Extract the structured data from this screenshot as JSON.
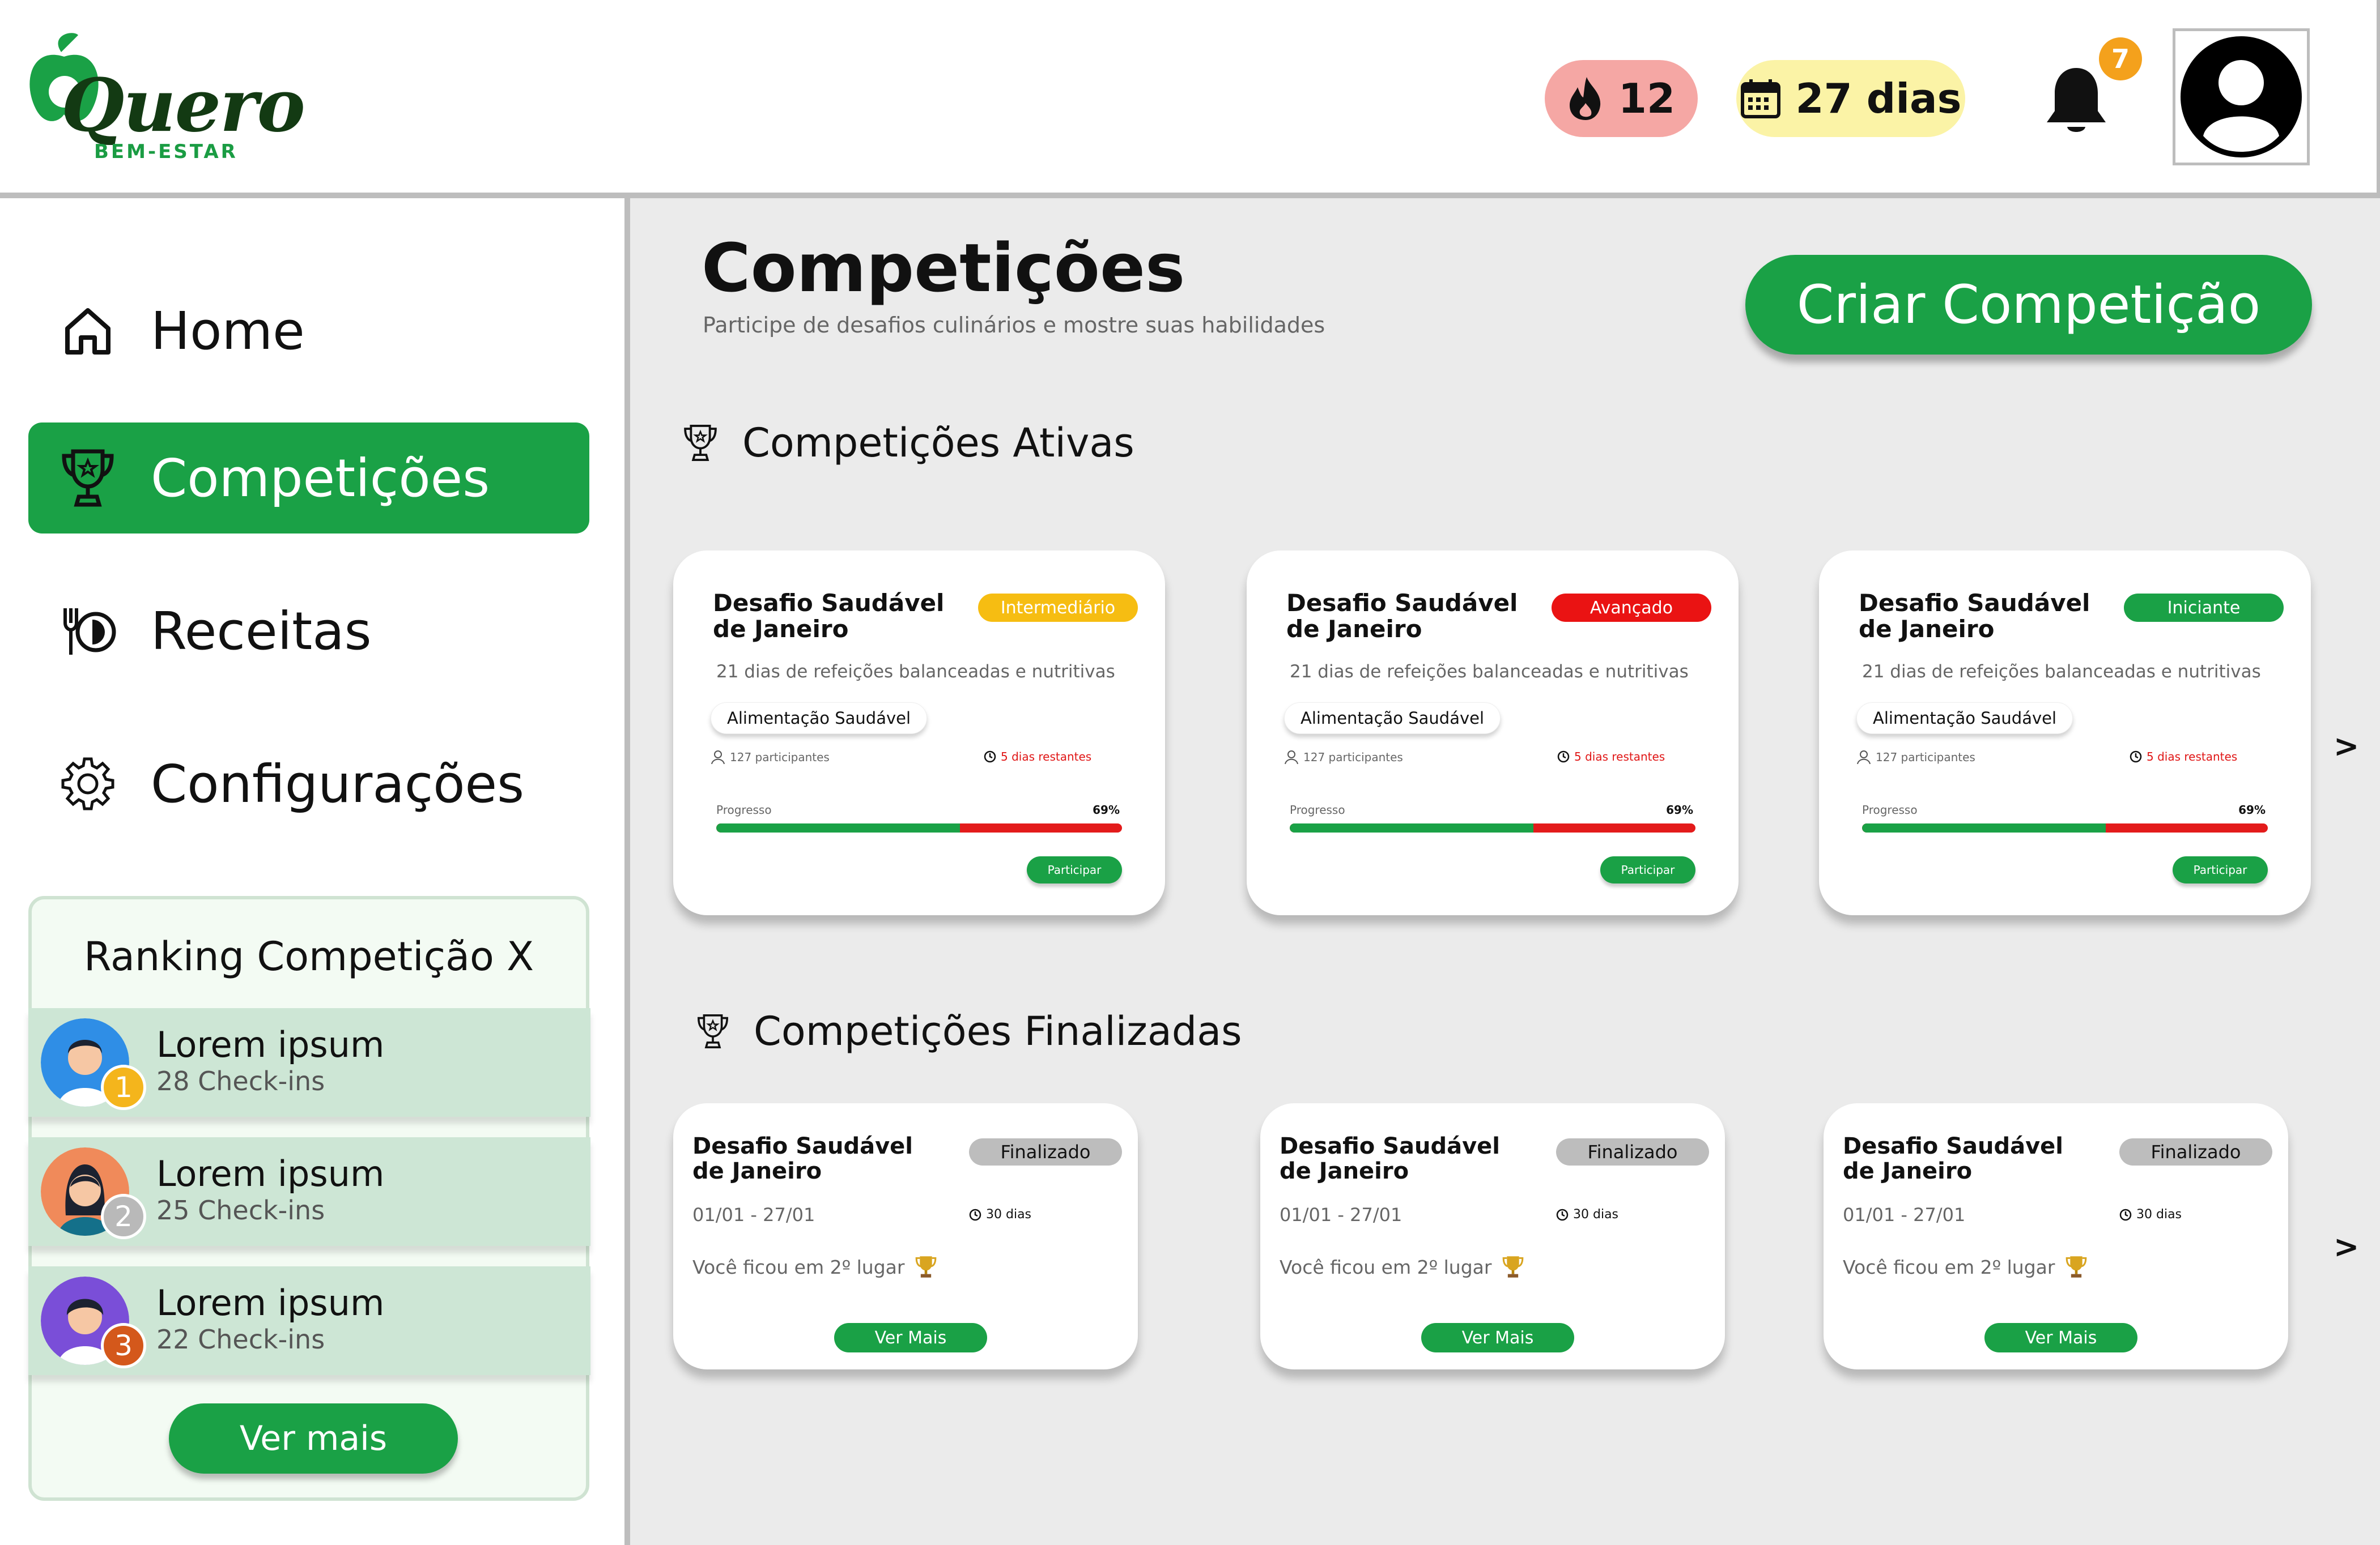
{
  "header": {
    "logo_word": "Quero",
    "logo_sub": "BEM-ESTAR",
    "streak_count": "12",
    "days_label": "27 dias",
    "notification_count": "7"
  },
  "sidebar": {
    "items": [
      {
        "label": "Home",
        "icon": "home-icon",
        "active": false
      },
      {
        "label": "Competições",
        "icon": "trophy-icon",
        "active": true
      },
      {
        "label": "Receitas",
        "icon": "cutlery-plate-icon",
        "active": false
      },
      {
        "label": "Configurações",
        "icon": "gear-icon",
        "active": false
      }
    ]
  },
  "ranking": {
    "title": "Ranking Competição X",
    "rows": [
      {
        "rank": "1",
        "name": "Lorem ipsum",
        "checkins": "28 Check-ins",
        "rank_color": "#f4b51c"
      },
      {
        "rank": "2",
        "name": "Lorem ipsum",
        "checkins": "25 Check-ins",
        "rank_color": "#b9b9b9"
      },
      {
        "rank": "3",
        "name": "Lorem ipsum",
        "checkins": "22 Check-ins",
        "rank_color": "#d4581b"
      }
    ],
    "more_label": "Ver mais"
  },
  "main": {
    "title": "Competições",
    "subtitle": "Participe de desafios culinários e mostre suas habilidades",
    "create_label": "Criar Competição",
    "active_heading": "Competições Ativas",
    "finished_heading": "Competições Finalizadas",
    "next_arrow": ">",
    "active_cards": [
      {
        "title": "Desafio Saudável de Janeiro",
        "level": "Intermediário",
        "level_color": "#f6bd12",
        "description": "21 dias de refeições balanceadas e nutritivas",
        "tag": "Alimentação Saudável",
        "participants": "127 participantes",
        "remaining": "5 dias restantes",
        "progress_label": "Progresso",
        "progress_text": "69%",
        "progress": 0.6,
        "join_label": "Participar"
      },
      {
        "title": "Desafio Saudável de Janeiro",
        "level": "Avançado",
        "level_color": "#ea1313",
        "description": "21 dias de refeições balanceadas e nutritivas",
        "tag": "Alimentação Saudável",
        "participants": "127 participantes",
        "remaining": "5 dias restantes",
        "progress_label": "Progresso",
        "progress_text": "69%",
        "progress": 0.6,
        "join_label": "Participar"
      },
      {
        "title": "Desafio Saudável de Janeiro",
        "level": "Iniciante",
        "level_color": "#1aa146",
        "description": "21 dias de refeições balanceadas e nutritivas",
        "tag": "Alimentação Saudável",
        "participants": "127 participantes",
        "remaining": "5 dias restantes",
        "progress_label": "Progresso",
        "progress_text": "69%",
        "progress": 0.6,
        "join_label": "Participar"
      }
    ],
    "finished_cards": [
      {
        "title": "Desafio Saudável de Janeiro",
        "status": "Finalizado",
        "dates": "01/01 - 27/01",
        "duration": "30 dias",
        "placement": "Você ficou em 2º lugar",
        "more_label": "Ver Mais"
      },
      {
        "title": "Desafio Saudável de Janeiro",
        "status": "Finalizado",
        "dates": "01/01 - 27/01",
        "duration": "30 dias",
        "placement": "Você ficou em 2º lugar",
        "more_label": "Ver Mais"
      },
      {
        "title": "Desafio Saudável de Janeiro",
        "status": "Finalizado",
        "dates": "01/01 - 27/01",
        "duration": "30 dias",
        "placement": "Você ficou em 2º lugar",
        "more_label": "Ver Mais"
      }
    ]
  }
}
